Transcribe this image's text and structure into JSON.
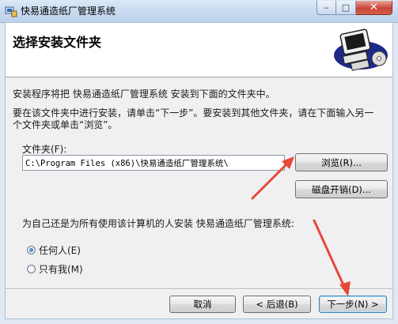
{
  "window": {
    "title": "快易通造纸厂管理系统",
    "minimize_label": "–",
    "maximize_label": "□",
    "close_label": "✕"
  },
  "header": {
    "title": "选择安装文件夹"
  },
  "body": {
    "intro": "安装程序将把 快易通造纸厂管理系统 安装到下面的文件夹中。",
    "instruction_line1": "要在该文件夹中进行安装，请单击“下一步”。要安装到其他文件夹，请在下面输入另一",
    "instruction_line2": "个文件夹或单击“浏览”。"
  },
  "folder": {
    "label": "文件夹(F):",
    "value": "C:\\Program Files (x86)\\快易通造纸厂管理系统\\",
    "browse_label": "浏览(R)...",
    "disk_cost_label": "磁盘开销(D)..."
  },
  "install_for": {
    "prompt": "为自己还是为所有使用该计算机的人安装 快易通造纸厂管理系统:",
    "options": [
      {
        "label": "任何人(E)",
        "selected": true
      },
      {
        "label": "只有我(M)",
        "selected": false
      }
    ]
  },
  "footer": {
    "cancel_label": "取消",
    "back_label": "< 后退(B)",
    "next_label": "下一步(N) >"
  },
  "colors": {
    "annotation_arrow": "#e8473a",
    "title_bar": "#c8daf0",
    "dialog_bg": "#f0f0f0"
  }
}
